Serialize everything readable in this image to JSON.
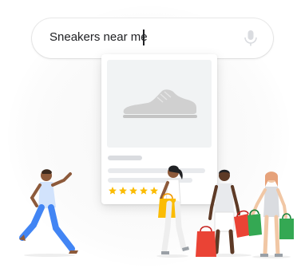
{
  "search": {
    "query": "Sneakers near me",
    "mic_icon": "mic-icon"
  },
  "product_card": {
    "image_icon": "sneaker-icon",
    "rating_stars": 5,
    "star_color": "#fbbc04"
  },
  "colors": {
    "accent_blue": "#4285f4",
    "accent_red": "#ea4335",
    "accent_yellow": "#fbbc04",
    "accent_green": "#34a853"
  }
}
